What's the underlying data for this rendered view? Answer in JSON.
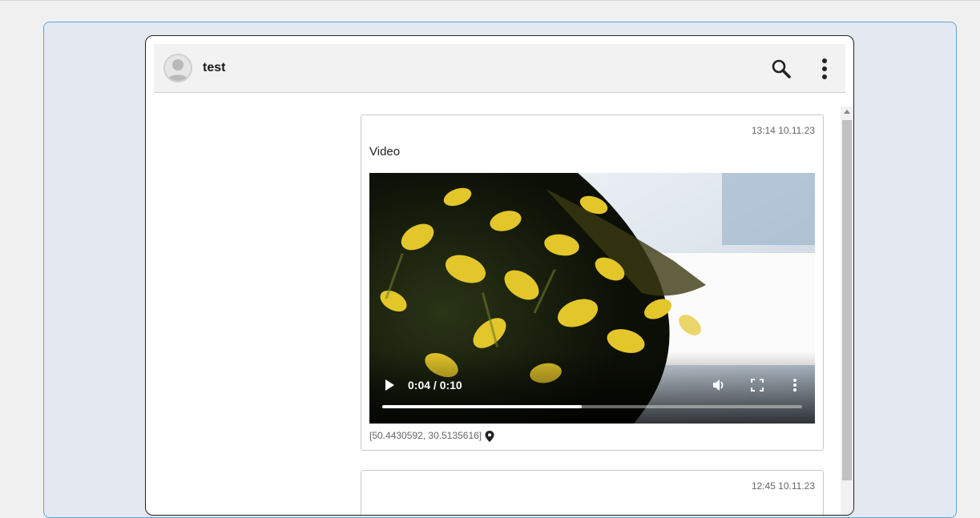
{
  "header": {
    "title": "test",
    "avatar_icon": "user-avatar-icon",
    "search_icon": "search-icon",
    "menu_icon": "more-vertical-icon"
  },
  "messages": [
    {
      "time": "13:14 10.11.23",
      "text": "Video",
      "video": {
        "current_time": "0:04",
        "duration": "0:10",
        "time_display": "0:04 / 0:10",
        "progress": 0.475
      },
      "coordinates": "[50.4430592, 30.5135616]",
      "location_icon": "map-pin-icon"
    },
    {
      "time": "12:45 10.11.23"
    }
  ],
  "colors": {
    "outer_bg": "#e4e8f0",
    "outer_border": "#5fa3dc",
    "header_bg": "#f2f2f2"
  }
}
